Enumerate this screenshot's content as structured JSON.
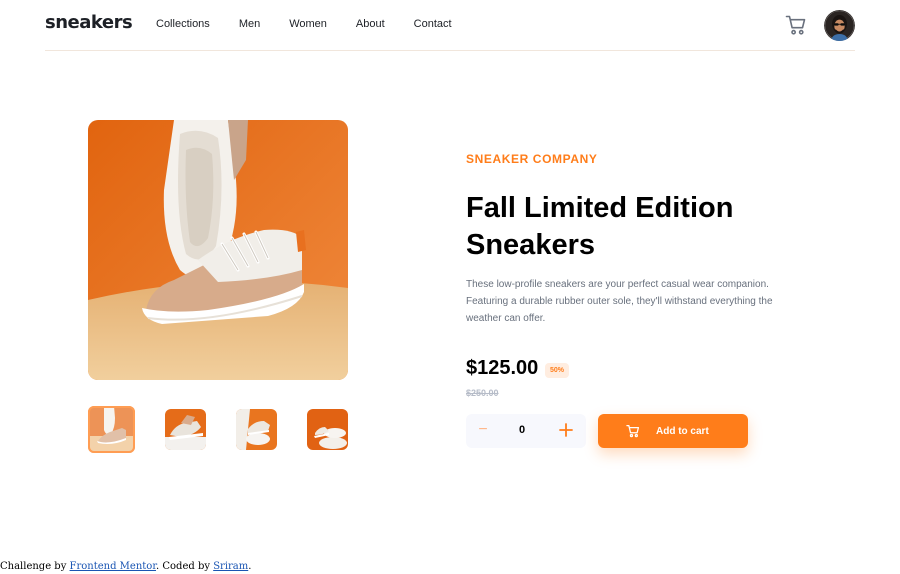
{
  "header": {
    "logo": "sneakers",
    "nav": [
      "Collections",
      "Men",
      "Women",
      "About",
      "Contact"
    ]
  },
  "product": {
    "company": "SNEAKER COMPANY",
    "title_line1": "Fall Limited Edition",
    "title_line2": "Sneakers",
    "description": "These low-profile sneakers are your perfect casual wear companion. Featuring a durable rubber outer sole, they'll withstand everything the weather can offer.",
    "price": "$125.00",
    "discount": "50%",
    "old_price": "$250.00",
    "quantity": "0",
    "add_to_cart": "Add to cart"
  },
  "gallery": {
    "thumbnails": 4,
    "active_thumbnail": 1
  },
  "attribution": {
    "prefix": "Challenge by ",
    "link1": "Frontend Mentor",
    "middle": ". Coded by ",
    "link2": "Sriram",
    "suffix": "."
  },
  "colors": {
    "accent": "#ff7d1a",
    "accent_pale": "#ffede0",
    "text_dark": "#1d2026",
    "text_muted": "#68707d"
  }
}
